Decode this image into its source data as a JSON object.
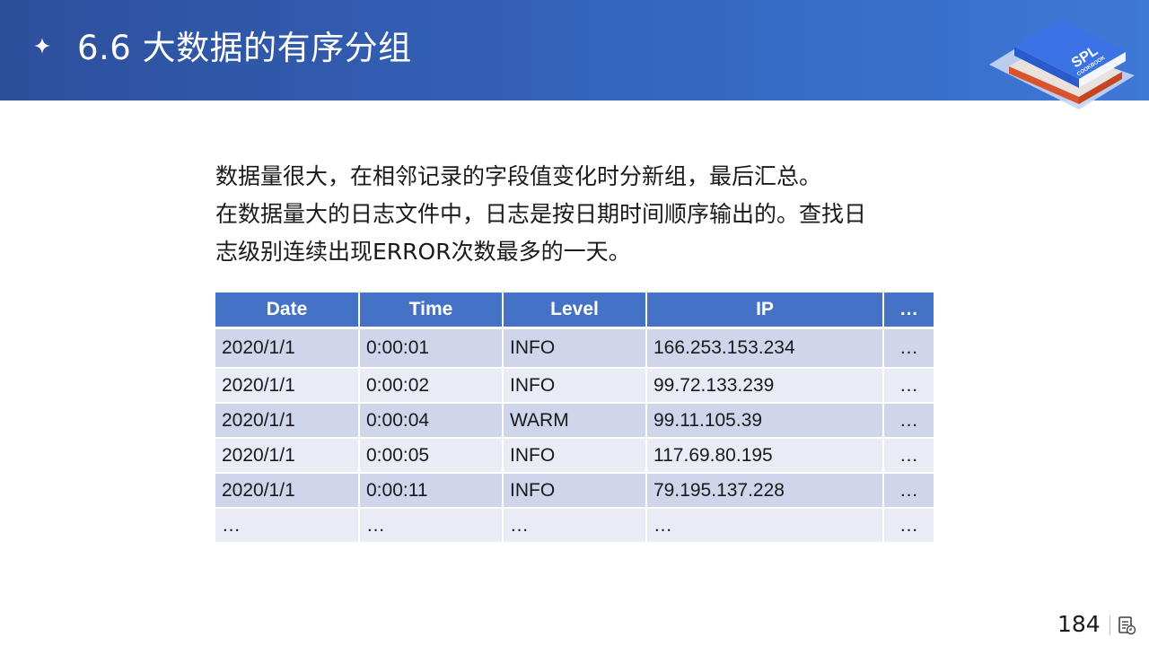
{
  "header": {
    "title": "6.6  大数据的有序分组",
    "logo": {
      "text": "SPL",
      "subtext": "COOKBOOK"
    }
  },
  "intro": {
    "lines": [
      "数据量很大，在相邻记录的字段值变化时分新组，最后汇总。",
      "在数据量大的日志文件中，日志是按日期时间顺序输出的。查找日",
      "志级别连续出现ERROR次数最多的一天。"
    ]
  },
  "table": {
    "columns": [
      "Date",
      "Time",
      "Level",
      "IP",
      "…"
    ],
    "rows": [
      [
        "2020/1/1",
        "0:00:01",
        "INFO",
        "166.253.153.234",
        "…"
      ],
      [
        "2020/1/1",
        "0:00:02",
        "INFO",
        "99.72.133.239",
        "…"
      ],
      [
        "2020/1/1",
        "0:00:04",
        "WARM",
        "99.11.105.39",
        "…"
      ],
      [
        "2020/1/1",
        "0:00:05",
        "INFO",
        "117.69.80.195",
        "…"
      ],
      [
        "2020/1/1",
        "0:00:11",
        "INFO",
        "79.195.137.228",
        "…"
      ],
      [
        "…",
        "…",
        "…",
        "…",
        "…"
      ]
    ]
  },
  "footer": {
    "page_number": "184"
  },
  "icons": {
    "header_bullet": "sparkle-icon",
    "footer": "notes-icon"
  },
  "colors": {
    "header_start": "#2d4f9c",
    "header_end": "#3e78d8",
    "table_header": "#4472c4",
    "row_odd": "#cfd5ea",
    "row_even": "#e9ebf5"
  }
}
